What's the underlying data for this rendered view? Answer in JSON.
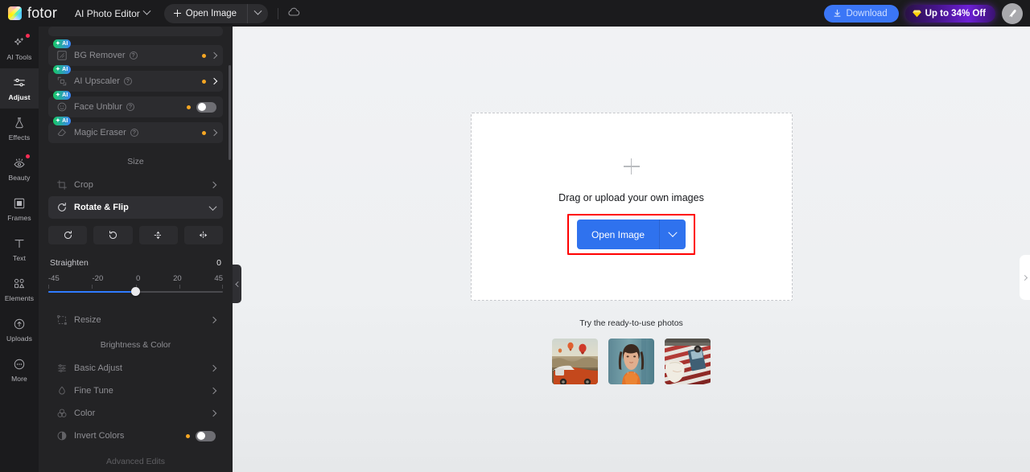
{
  "header": {
    "brand": "fotor",
    "mode_label": "AI Photo Editor",
    "open_image_label": "Open Image",
    "download_label": "Download",
    "promo_label": "Up to 34% Off",
    "cloud_icon": "cloud-icon",
    "avatar_icon": "bird-avatar-icon"
  },
  "rail": {
    "items": [
      {
        "label": "AI Tools",
        "icon": "sparkle-icon",
        "dot": true,
        "active": false
      },
      {
        "label": "Adjust",
        "icon": "sliders-icon",
        "dot": false,
        "active": true
      },
      {
        "label": "Effects",
        "icon": "flask-icon",
        "dot": false,
        "active": false
      },
      {
        "label": "Beauty",
        "icon": "eye-icon",
        "dot": true,
        "active": false
      },
      {
        "label": "Frames",
        "icon": "frame-icon",
        "dot": false,
        "active": false
      },
      {
        "label": "Text",
        "icon": "text-t-icon",
        "dot": false,
        "active": false
      },
      {
        "label": "Elements",
        "icon": "shapes-icon",
        "dot": false,
        "active": false
      },
      {
        "label": "Uploads",
        "icon": "upload-cloud-icon",
        "dot": false,
        "active": false
      },
      {
        "label": "More",
        "icon": "more-dots-icon",
        "dot": false,
        "active": false
      }
    ]
  },
  "panel": {
    "ai_tools": [
      {
        "label": "BG Remover",
        "badge": "AI",
        "icon": "bg-remover-icon",
        "dot": true,
        "control": "chevron"
      },
      {
        "label": "AI Upscaler",
        "badge": "AI",
        "icon": "upscale-icon",
        "dot": true,
        "control": "chevron-bright"
      },
      {
        "label": "Face Unblur",
        "badge": "AI",
        "icon": "face-icon",
        "dot": true,
        "control": "toggle"
      },
      {
        "label": "Magic Eraser",
        "badge": "AI",
        "icon": "eraser-icon",
        "dot": true,
        "control": "chevron"
      }
    ],
    "size_section_title": "Size",
    "size_items": [
      {
        "label": "Crop",
        "icon": "crop-icon",
        "selected": false
      },
      {
        "label": "Rotate & Flip",
        "icon": "rotate-icon",
        "selected": true
      }
    ],
    "flip_buttons": [
      {
        "name": "rotate-right-button",
        "icon": "rotate-cw-icon"
      },
      {
        "name": "rotate-left-button",
        "icon": "rotate-ccw-icon"
      },
      {
        "name": "flip-vertical-button",
        "icon": "flip-vertical-icon"
      },
      {
        "name": "flip-horizontal-button",
        "icon": "flip-horizontal-icon"
      }
    ],
    "straighten": {
      "label": "Straighten",
      "value": "0",
      "ticks": [
        "-45",
        "-20",
        "0",
        "20",
        "45"
      ],
      "min": -45,
      "max": 45,
      "current": 0,
      "accent_color": "#2f7bff"
    },
    "resize_item": {
      "label": "Resize",
      "icon": "resize-icon"
    },
    "color_section_title": "Brightness & Color",
    "color_items": [
      {
        "label": "Basic Adjust",
        "icon": "basic-adjust-icon",
        "control": "chevron",
        "dot": false
      },
      {
        "label": "Fine Tune",
        "icon": "droplet-icon",
        "control": "chevron",
        "dot": false
      },
      {
        "label": "Color",
        "icon": "color-circles-icon",
        "control": "chevron",
        "dot": false
      },
      {
        "label": "Invert Colors",
        "icon": "invert-icon",
        "control": "toggle",
        "dot": true
      }
    ],
    "advanced_section_title": "Advanced Edits"
  },
  "canvas": {
    "dropzone_text": "Drag or upload your own images",
    "open_image_label": "Open Image",
    "highlight_color": "#ff0000",
    "ready_title": "Try the ready-to-use photos",
    "thumbnails": [
      {
        "name": "thumbnail-balloons-car",
        "alt": "Hot air balloons over valley with orange classic car"
      },
      {
        "name": "thumbnail-portrait-woman",
        "alt": "Portrait of woman in orange top against teal wall"
      },
      {
        "name": "thumbnail-striped-picnic",
        "alt": "Red and white striped blanket with tote bag"
      }
    ]
  }
}
